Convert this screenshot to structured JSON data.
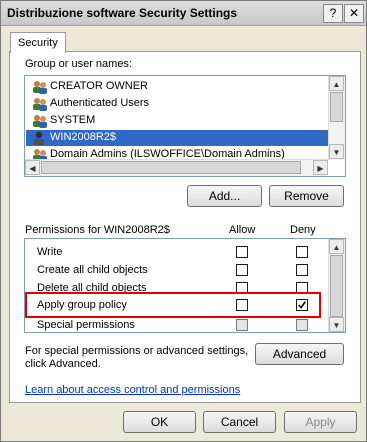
{
  "window": {
    "title": "Distribuzione software Security Settings",
    "help_glyph": "?",
    "close_glyph": "✕"
  },
  "tabs": [
    {
      "label": "Security"
    }
  ],
  "group_section": {
    "label": "Group or user names:",
    "users": [
      {
        "name": "CREATOR OWNER",
        "icon": "user-group-icon",
        "selected": false
      },
      {
        "name": "Authenticated Users",
        "icon": "user-group-icon",
        "selected": false
      },
      {
        "name": "SYSTEM",
        "icon": "user-group-icon",
        "selected": false
      },
      {
        "name": "WIN2008R2$",
        "icon": "computer-account-icon",
        "selected": true
      },
      {
        "name": "Domain Admins (ILSWOFFICE\\Domain Admins)",
        "icon": "user-group-icon",
        "selected": false
      }
    ],
    "add_label": "Add...",
    "remove_label": "Remove"
  },
  "permissions": {
    "label": "Permissions for WIN2008R2$",
    "allow_header": "Allow",
    "deny_header": "Deny",
    "rows": [
      {
        "name": "Write",
        "allow": false,
        "deny": false
      },
      {
        "name": "Create all child objects",
        "allow": false,
        "deny": false
      },
      {
        "name": "Delete all child objects",
        "allow": false,
        "deny": false
      },
      {
        "name": "Apply group policy",
        "allow": false,
        "deny": true
      },
      {
        "name": "Special permissions",
        "allow": false,
        "deny": false
      }
    ]
  },
  "advanced": {
    "text_line1": "For special permissions or advanced settings,",
    "text_line2": "click Advanced.",
    "button_label": "Advanced"
  },
  "link_text": "Learn about access control and permissions",
  "footer": {
    "ok_label": "OK",
    "cancel_label": "Cancel",
    "apply_label": "Apply"
  },
  "colors": {
    "selection": "#316ac5",
    "highlight_box": "#e00000",
    "link": "#0033cc"
  }
}
